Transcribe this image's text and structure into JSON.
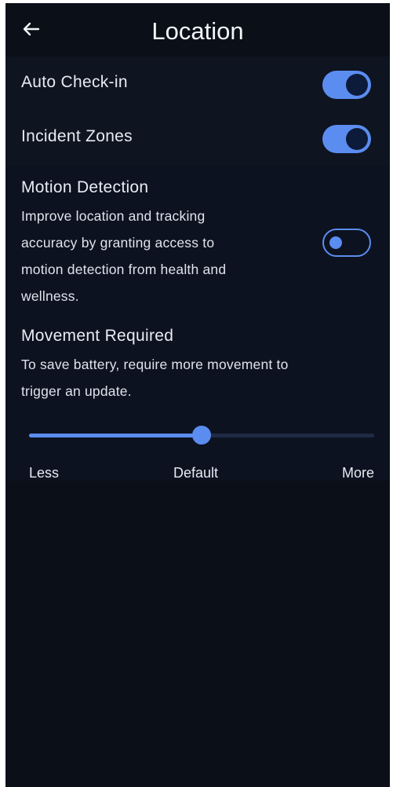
{
  "header": {
    "title": "Location",
    "back_icon": "arrow-left-icon"
  },
  "toggles": {
    "auto_checkin": {
      "label": "Auto Check-in",
      "enabled": true
    },
    "incident_zones": {
      "label": "Incident Zones",
      "enabled": true
    }
  },
  "motion": {
    "title": "Motion Detection",
    "description_lines": [
      "Improve location and tracking",
      "accuracy by granting access to",
      "motion detection from health and",
      "wellness."
    ],
    "enabled": false
  },
  "movement": {
    "title": "Movement Required",
    "description_lines": [
      "To save battery, require more movement to",
      "trigger an update."
    ],
    "slider_value": 0.5,
    "labels": {
      "min": "Less",
      "mid": "Default",
      "max": "More"
    }
  },
  "colors": {
    "accent": "#5b8df0",
    "background": "#0b0f18",
    "text": "#e8ebf2"
  }
}
